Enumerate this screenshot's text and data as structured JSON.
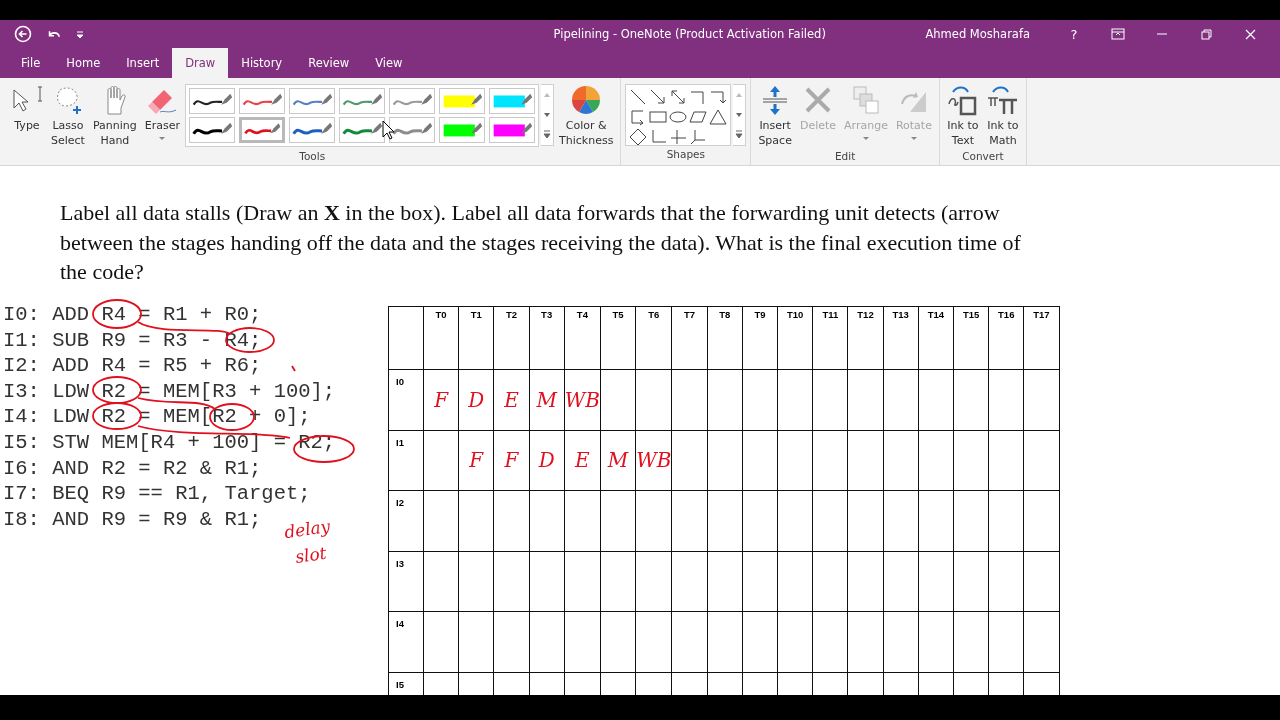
{
  "window": {
    "title": "Pipelining - OneNote (Product Activation Failed)",
    "user": "Ahmed Mosharafa",
    "help": "?"
  },
  "tabs": [
    {
      "label": "File",
      "selected": false
    },
    {
      "label": "Home",
      "selected": false
    },
    {
      "label": "Insert",
      "selected": false
    },
    {
      "label": "Draw",
      "selected": true
    },
    {
      "label": "History",
      "selected": false
    },
    {
      "label": "Review",
      "selected": false
    },
    {
      "label": "View",
      "selected": false
    }
  ],
  "ribbon": {
    "groups": [
      {
        "label": "Tools",
        "items": [
          {
            "kind": "button",
            "label": "Type",
            "disabled": false
          },
          {
            "kind": "button",
            "label": "Lasso\nSelect",
            "disabled": false
          },
          {
            "kind": "button",
            "label": "Panning\nHand",
            "disabled": false
          },
          {
            "kind": "dropdown",
            "label": "Eraser",
            "disabled": false
          },
          {
            "kind": "pens",
            "pens": [
              {
                "kind": "pen",
                "color": "#222222",
                "selected": false
              },
              {
                "kind": "pen",
                "color": "#e8424a",
                "selected": false
              },
              {
                "kind": "pen",
                "color": "#5b7fc0",
                "selected": false
              },
              {
                "kind": "pen",
                "color": "#4d9a6a",
                "selected": false
              },
              {
                "kind": "pen",
                "color": "#9a9a9a",
                "selected": false
              },
              {
                "kind": "highlighter",
                "color": "#ffff00",
                "selected": false
              },
              {
                "kind": "highlighter",
                "color": "#00e5ff",
                "selected": false
              },
              {
                "kind": "pen",
                "color": "#000000",
                "selected": false
              },
              {
                "kind": "pen",
                "color": "#e0101e",
                "selected": true
              },
              {
                "kind": "pen",
                "color": "#1f5fbf",
                "selected": false
              },
              {
                "kind": "pen",
                "color": "#128a3c",
                "selected": false
              },
              {
                "kind": "pen",
                "color": "#8c8c8c",
                "selected": false
              },
              {
                "kind": "highlighter",
                "color": "#00ff00",
                "selected": false
              },
              {
                "kind": "highlighter",
                "color": "#ff00ff",
                "selected": false
              }
            ]
          },
          {
            "kind": "button",
            "label": "Color &\nThickness",
            "disabled": false
          }
        ]
      },
      {
        "label": "Shapes",
        "items": [
          {
            "kind": "shapes"
          }
        ]
      },
      {
        "label": "Edit",
        "items": [
          {
            "kind": "button",
            "label": "Insert\nSpace",
            "disabled": false
          },
          {
            "kind": "button",
            "label": "Delete",
            "disabled": true
          },
          {
            "kind": "dropdown",
            "label": "Arrange",
            "disabled": true
          },
          {
            "kind": "dropdown",
            "label": "Rotate",
            "disabled": true
          }
        ]
      },
      {
        "label": "Convert",
        "items": [
          {
            "kind": "button",
            "label": "Ink to\nText",
            "disabled": false
          },
          {
            "kind": "button",
            "label": "Ink to\nMath",
            "disabled": false
          }
        ]
      }
    ]
  },
  "page": {
    "question": "Label all data stalls (Draw an **X** in the box). Label all data forwards that the forwarding unit detects (arrow between the stages handing off the data and the stages receiving the data).  What is the final execution time of the code?",
    "code": [
      "I0: ADD R4 = R1 + R0;",
      "I1: SUB R9 = R3 - R4;",
      "I2: ADD R4 = R5 + R6;",
      "I3: LDW R2 = MEM[R3 + 100];",
      "I4: LDW R2 = MEM[R2 + 0];",
      "I5: STW MEM[R4 + 100] = R2;",
      "I6: AND R2 = R2 & R1;",
      "I7: BEQ R9 == R1, Target;",
      "I8: AND R9 = R9 & R1;"
    ],
    "ink_note": "delay slot",
    "table": {
      "columns": [
        "T0",
        "T1",
        "T2",
        "T3",
        "T4",
        "T5",
        "T6",
        "T7",
        "T8",
        "T9",
        "T10",
        "T11",
        "T12",
        "T13",
        "T14",
        "T15",
        "T16",
        "T17"
      ],
      "rows": [
        {
          "label": "I0",
          "cells": [
            "F",
            "D",
            "E",
            "M",
            "WB",
            null,
            null,
            null,
            null,
            null,
            null,
            null,
            null,
            null,
            null,
            null,
            null,
            null
          ]
        },
        {
          "label": "I1",
          "cells": [
            null,
            "F",
            "F",
            "D",
            "E",
            "M",
            "WB",
            null,
            null,
            null,
            null,
            null,
            null,
            null,
            null,
            null,
            null,
            null
          ]
        },
        {
          "label": "I2",
          "cells": [
            null,
            null,
            null,
            null,
            null,
            null,
            null,
            null,
            null,
            null,
            null,
            null,
            null,
            null,
            null,
            null,
            null,
            null
          ]
        },
        {
          "label": "I3",
          "cells": [
            null,
            null,
            null,
            null,
            null,
            null,
            null,
            null,
            null,
            null,
            null,
            null,
            null,
            null,
            null,
            null,
            null,
            null
          ]
        },
        {
          "label": "I4",
          "cells": [
            null,
            null,
            null,
            null,
            null,
            null,
            null,
            null,
            null,
            null,
            null,
            null,
            null,
            null,
            null,
            null,
            null,
            null
          ]
        },
        {
          "label": "I5",
          "cells": [
            null,
            null,
            null,
            null,
            null,
            null,
            null,
            null,
            null,
            null,
            null,
            null,
            null,
            null,
            null,
            null,
            null,
            null
          ]
        }
      ]
    }
  }
}
